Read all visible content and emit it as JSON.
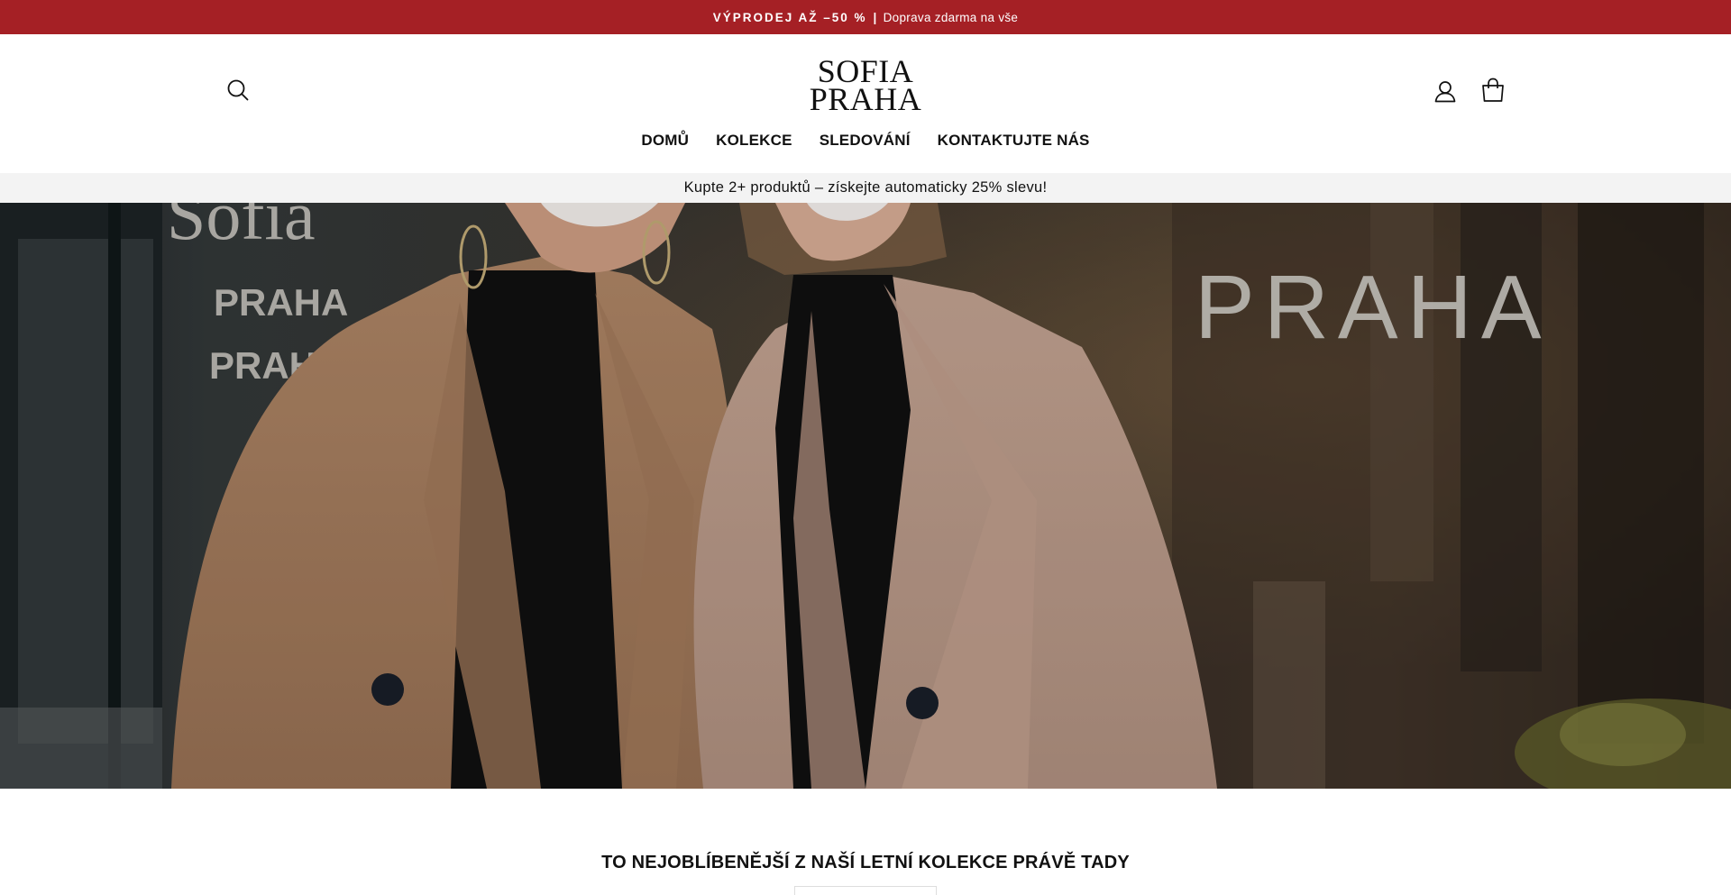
{
  "announcement": {
    "strong_text": "VÝPRODEJ AŽ –50 %",
    "separator": "|",
    "text": "Doprava zdarma na vše",
    "background_color": "#a52025"
  },
  "header": {
    "logo_line1": "SOFIA",
    "logo_line2": "PRAHA",
    "search_icon": "search-icon",
    "account_icon": "user-icon",
    "cart_icon": "shopping-bag-icon"
  },
  "nav": {
    "items": [
      {
        "label": "DOMŮ"
      },
      {
        "label": "KOLEKCE"
      },
      {
        "label": "SLEDOVÁNÍ"
      },
      {
        "label": "KONTAKTUJTE NÁS"
      }
    ]
  },
  "promo": {
    "text": "Kupte 2+ produktů – získejte automaticky 25% slevu!"
  },
  "hero": {
    "storefront_text_right": "PRAHA",
    "storefront_text_left_1": "Sofia",
    "storefront_text_left_2": "PRAHA",
    "storefront_text_left_3": "PRAHA"
  },
  "section": {
    "title": "TO NEJOBLÍBENĚJŠÍ Z NAŠÍ LETNÍ KOLEKCE PRÁVĚ TADY"
  }
}
